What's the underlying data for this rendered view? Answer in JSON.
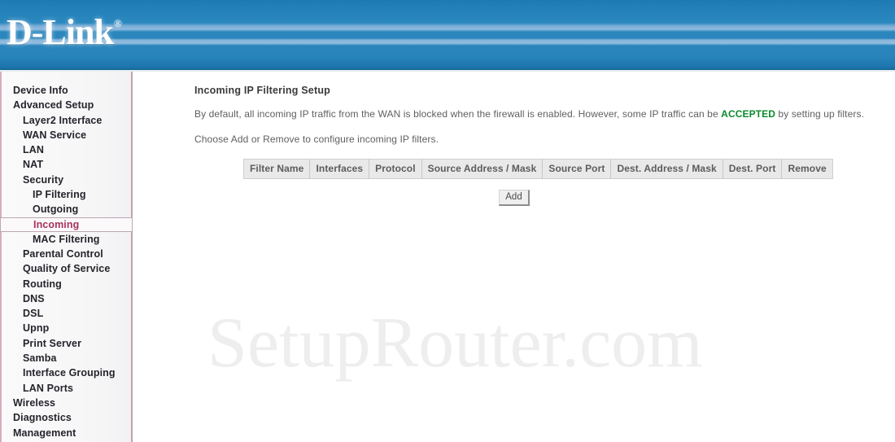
{
  "header": {
    "brand": "D-Link",
    "trademark": "®"
  },
  "sidebar": {
    "items": [
      {
        "label": "Device Info",
        "level": 0,
        "selected": false
      },
      {
        "label": "Advanced Setup",
        "level": 0,
        "selected": false
      },
      {
        "label": "Layer2 Interface",
        "level": 1,
        "selected": false
      },
      {
        "label": "WAN Service",
        "level": 1,
        "selected": false
      },
      {
        "label": "LAN",
        "level": 1,
        "selected": false
      },
      {
        "label": "NAT",
        "level": 1,
        "selected": false
      },
      {
        "label": "Security",
        "level": 1,
        "selected": false
      },
      {
        "label": "IP Filtering",
        "level": 2,
        "selected": false
      },
      {
        "label": "Outgoing",
        "level": 2,
        "selected": false
      },
      {
        "label": "Incoming",
        "level": 2,
        "selected": true
      },
      {
        "label": "MAC Filtering",
        "level": 2,
        "selected": false
      },
      {
        "label": "Parental Control",
        "level": 1,
        "selected": false
      },
      {
        "label": "Quality of Service",
        "level": 1,
        "selected": false
      },
      {
        "label": "Routing",
        "level": 1,
        "selected": false
      },
      {
        "label": "DNS",
        "level": 1,
        "selected": false
      },
      {
        "label": "DSL",
        "level": 1,
        "selected": false
      },
      {
        "label": "Upnp",
        "level": 1,
        "selected": false
      },
      {
        "label": "Print Server",
        "level": 1,
        "selected": false
      },
      {
        "label": "Samba",
        "level": 1,
        "selected": false
      },
      {
        "label": "Interface Grouping",
        "level": 1,
        "selected": false
      },
      {
        "label": "LAN Ports",
        "level": 1,
        "selected": false
      },
      {
        "label": "Wireless",
        "level": 0,
        "selected": false
      },
      {
        "label": "Diagnostics",
        "level": 0,
        "selected": false
      },
      {
        "label": "Management",
        "level": 0,
        "selected": false
      }
    ]
  },
  "main": {
    "title": "Incoming IP Filtering Setup",
    "description_part1": "By default, all incoming IP traffic from the WAN is blocked when the firewall is enabled. However, some IP traffic can be ",
    "description_accent": "ACCEPTED",
    "description_part2": " by setting up filters.",
    "instruction": "Choose Add or Remove to configure incoming IP filters.",
    "table": {
      "columns": [
        "Filter Name",
        "Interfaces",
        "Protocol",
        "Source Address / Mask",
        "Source Port",
        "Dest. Address / Mask",
        "Dest. Port",
        "Remove"
      ],
      "rows": []
    },
    "add_button_label": "Add"
  },
  "watermark": {
    "text": "SetupRouter.com"
  },
  "colors": {
    "header_blue": "#2481b9",
    "accent_green": "#0b8a2c",
    "selected_nav": "#a8325c",
    "sidebar_border": "#c59fb2"
  }
}
